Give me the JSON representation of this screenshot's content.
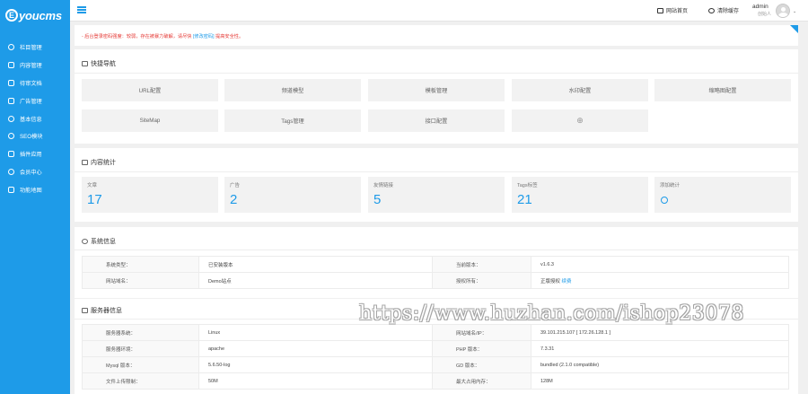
{
  "brand": {
    "logo_mark": "E",
    "logo_text": "youcms"
  },
  "sidebar": {
    "items": [
      {
        "label": "栏目管理",
        "icon": "gear-icon"
      },
      {
        "label": "内容管理",
        "icon": "document-icon"
      },
      {
        "label": "待审文档",
        "icon": "list-icon"
      },
      {
        "label": "广告管理",
        "icon": "ad-icon"
      },
      {
        "label": "基本信息",
        "icon": "settings-icon"
      },
      {
        "label": "SEO模块",
        "icon": "seo-icon"
      },
      {
        "label": "插件应用",
        "icon": "plugin-icon"
      },
      {
        "label": "会员中心",
        "icon": "user-icon"
      },
      {
        "label": "功能地图",
        "icon": "map-icon"
      }
    ]
  },
  "topbar": {
    "site_home": "网站首页",
    "clear_cache": "清除缓存",
    "admin_name": "admin",
    "admin_role": "创始人"
  },
  "alert": {
    "text": "- 后台登录密码强度：较弱，存在被暴力破解，请尽快",
    "link": "[修改密码]",
    "suffix": "提高安全性。"
  },
  "quick_nav": {
    "title": "快捷导航",
    "items": [
      "URL配置",
      "频道模型",
      "模板管理",
      "水印配置",
      "缩略图配置",
      "SiteMap",
      "Tags管理",
      "接口配置",
      "⊕"
    ]
  },
  "content_stats": {
    "title": "内容统计",
    "items": [
      {
        "label": "文章",
        "value": "17"
      },
      {
        "label": "广告",
        "value": "2"
      },
      {
        "label": "友情链接",
        "value": "5"
      },
      {
        "label": "Tags标签",
        "value": "21"
      },
      {
        "label": "添加统计",
        "value": ""
      }
    ]
  },
  "system_info": {
    "title": "系统信息",
    "rows": [
      [
        "系统类型：",
        "已安装版本",
        "当前版本：",
        "v1.6.3"
      ],
      [
        "网站域名：",
        "Demo站点",
        "授权所有：",
        "正版授权 "
      ]
    ],
    "auth_link": "续费"
  },
  "server_info": {
    "title": "服务器信息",
    "rows": [
      [
        "服务器系统：",
        "Linux",
        "网站域名/IP：",
        "39.101.215.107 [ 172.26.128.1 ]"
      ],
      [
        "服务器环境：",
        "apache",
        "PHP 版本：",
        "7.3.31"
      ],
      [
        "Mysql 版本：",
        "5.6.50-log",
        "GD 版本：",
        "bundled (2.1.0 compatible)"
      ],
      [
        "文件上传限制：",
        "50M",
        "最大占用内存：",
        "128M"
      ]
    ]
  },
  "watermark": "https://www.huzhan.com/ishop23078"
}
